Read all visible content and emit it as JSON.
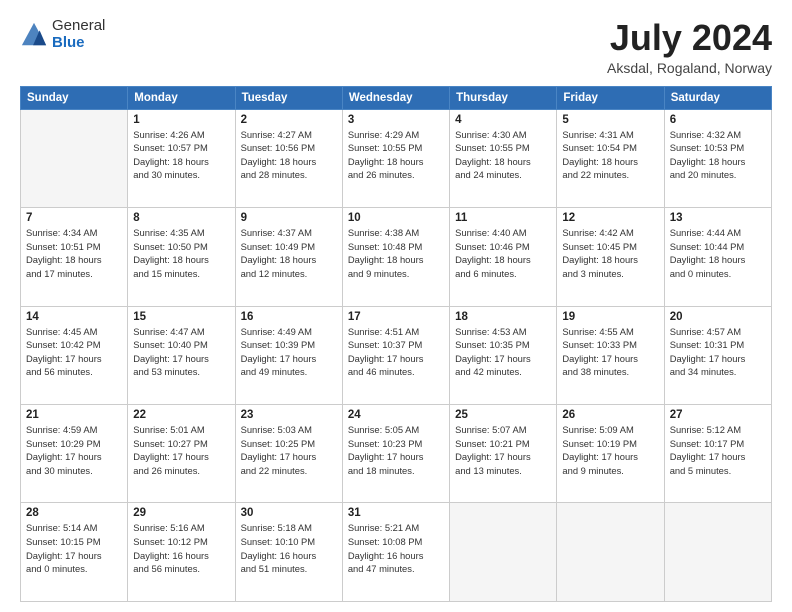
{
  "logo": {
    "general": "General",
    "blue": "Blue"
  },
  "header": {
    "title": "July 2024",
    "subtitle": "Aksdal, Rogaland, Norway"
  },
  "weekdays": [
    "Sunday",
    "Monday",
    "Tuesday",
    "Wednesday",
    "Thursday",
    "Friday",
    "Saturday"
  ],
  "weeks": [
    [
      {
        "day": "",
        "info": ""
      },
      {
        "day": "1",
        "info": "Sunrise: 4:26 AM\nSunset: 10:57 PM\nDaylight: 18 hours\nand 30 minutes."
      },
      {
        "day": "2",
        "info": "Sunrise: 4:27 AM\nSunset: 10:56 PM\nDaylight: 18 hours\nand 28 minutes."
      },
      {
        "day": "3",
        "info": "Sunrise: 4:29 AM\nSunset: 10:55 PM\nDaylight: 18 hours\nand 26 minutes."
      },
      {
        "day": "4",
        "info": "Sunrise: 4:30 AM\nSunset: 10:55 PM\nDaylight: 18 hours\nand 24 minutes."
      },
      {
        "day": "5",
        "info": "Sunrise: 4:31 AM\nSunset: 10:54 PM\nDaylight: 18 hours\nand 22 minutes."
      },
      {
        "day": "6",
        "info": "Sunrise: 4:32 AM\nSunset: 10:53 PM\nDaylight: 18 hours\nand 20 minutes."
      }
    ],
    [
      {
        "day": "7",
        "info": "Sunrise: 4:34 AM\nSunset: 10:51 PM\nDaylight: 18 hours\nand 17 minutes."
      },
      {
        "day": "8",
        "info": "Sunrise: 4:35 AM\nSunset: 10:50 PM\nDaylight: 18 hours\nand 15 minutes."
      },
      {
        "day": "9",
        "info": "Sunrise: 4:37 AM\nSunset: 10:49 PM\nDaylight: 18 hours\nand 12 minutes."
      },
      {
        "day": "10",
        "info": "Sunrise: 4:38 AM\nSunset: 10:48 PM\nDaylight: 18 hours\nand 9 minutes."
      },
      {
        "day": "11",
        "info": "Sunrise: 4:40 AM\nSunset: 10:46 PM\nDaylight: 18 hours\nand 6 minutes."
      },
      {
        "day": "12",
        "info": "Sunrise: 4:42 AM\nSunset: 10:45 PM\nDaylight: 18 hours\nand 3 minutes."
      },
      {
        "day": "13",
        "info": "Sunrise: 4:44 AM\nSunset: 10:44 PM\nDaylight: 18 hours\nand 0 minutes."
      }
    ],
    [
      {
        "day": "14",
        "info": "Sunrise: 4:45 AM\nSunset: 10:42 PM\nDaylight: 17 hours\nand 56 minutes."
      },
      {
        "day": "15",
        "info": "Sunrise: 4:47 AM\nSunset: 10:40 PM\nDaylight: 17 hours\nand 53 minutes."
      },
      {
        "day": "16",
        "info": "Sunrise: 4:49 AM\nSunset: 10:39 PM\nDaylight: 17 hours\nand 49 minutes."
      },
      {
        "day": "17",
        "info": "Sunrise: 4:51 AM\nSunset: 10:37 PM\nDaylight: 17 hours\nand 46 minutes."
      },
      {
        "day": "18",
        "info": "Sunrise: 4:53 AM\nSunset: 10:35 PM\nDaylight: 17 hours\nand 42 minutes."
      },
      {
        "day": "19",
        "info": "Sunrise: 4:55 AM\nSunset: 10:33 PM\nDaylight: 17 hours\nand 38 minutes."
      },
      {
        "day": "20",
        "info": "Sunrise: 4:57 AM\nSunset: 10:31 PM\nDaylight: 17 hours\nand 34 minutes."
      }
    ],
    [
      {
        "day": "21",
        "info": "Sunrise: 4:59 AM\nSunset: 10:29 PM\nDaylight: 17 hours\nand 30 minutes."
      },
      {
        "day": "22",
        "info": "Sunrise: 5:01 AM\nSunset: 10:27 PM\nDaylight: 17 hours\nand 26 minutes."
      },
      {
        "day": "23",
        "info": "Sunrise: 5:03 AM\nSunset: 10:25 PM\nDaylight: 17 hours\nand 22 minutes."
      },
      {
        "day": "24",
        "info": "Sunrise: 5:05 AM\nSunset: 10:23 PM\nDaylight: 17 hours\nand 18 minutes."
      },
      {
        "day": "25",
        "info": "Sunrise: 5:07 AM\nSunset: 10:21 PM\nDaylight: 17 hours\nand 13 minutes."
      },
      {
        "day": "26",
        "info": "Sunrise: 5:09 AM\nSunset: 10:19 PM\nDaylight: 17 hours\nand 9 minutes."
      },
      {
        "day": "27",
        "info": "Sunrise: 5:12 AM\nSunset: 10:17 PM\nDaylight: 17 hours\nand 5 minutes."
      }
    ],
    [
      {
        "day": "28",
        "info": "Sunrise: 5:14 AM\nSunset: 10:15 PM\nDaylight: 17 hours\nand 0 minutes."
      },
      {
        "day": "29",
        "info": "Sunrise: 5:16 AM\nSunset: 10:12 PM\nDaylight: 16 hours\nand 56 minutes."
      },
      {
        "day": "30",
        "info": "Sunrise: 5:18 AM\nSunset: 10:10 PM\nDaylight: 16 hours\nand 51 minutes."
      },
      {
        "day": "31",
        "info": "Sunrise: 5:21 AM\nSunset: 10:08 PM\nDaylight: 16 hours\nand 47 minutes."
      },
      {
        "day": "",
        "info": ""
      },
      {
        "day": "",
        "info": ""
      },
      {
        "day": "",
        "info": ""
      }
    ]
  ]
}
